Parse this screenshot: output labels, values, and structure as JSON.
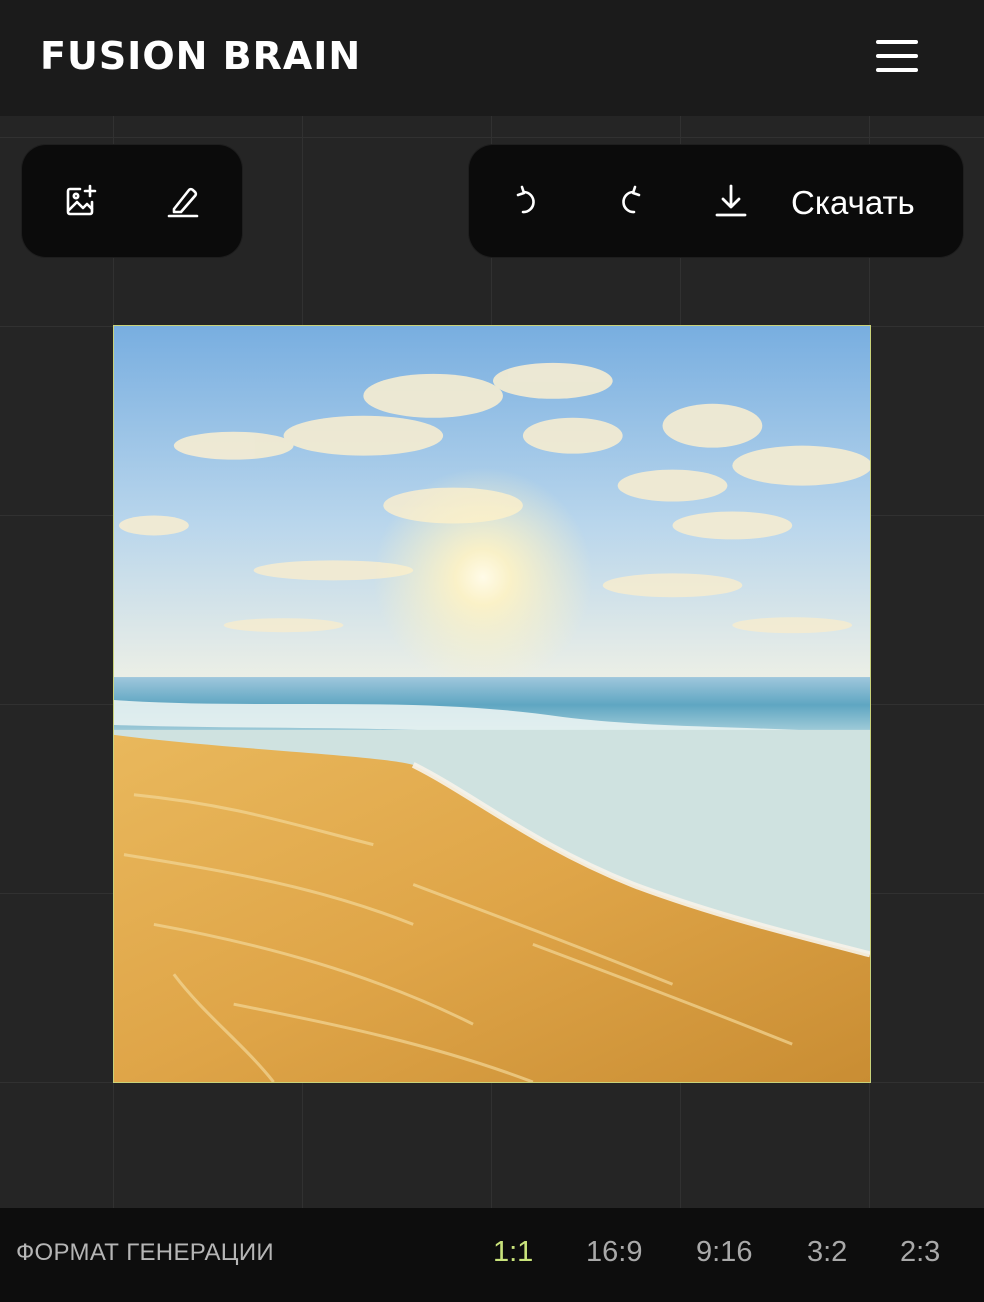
{
  "header": {
    "logo_text": "FUSION BRAIN",
    "menu_icon": "hamburger-menu-icon"
  },
  "toolbar_left": {
    "items": [
      {
        "name": "add-image-icon"
      },
      {
        "name": "eraser-icon"
      }
    ]
  },
  "toolbar_right": {
    "items": [
      {
        "name": "undo-icon"
      },
      {
        "name": "redo-icon"
      },
      {
        "name": "download-icon"
      }
    ],
    "download_label": "Скачать"
  },
  "image": {
    "description_icon": "generated-beach-image"
  },
  "footer": {
    "format_label": "ФОРМАТ ГЕНЕРАЦИИ",
    "ratios": [
      "1:1",
      "16:9",
      "9:16",
      "3:2",
      "2:3"
    ],
    "selected_ratio": "1:1"
  },
  "colors": {
    "accent": "#c9e37b",
    "background": "#252525",
    "header": "#1b1b1b",
    "toolbar": "#0b0b0b"
  }
}
